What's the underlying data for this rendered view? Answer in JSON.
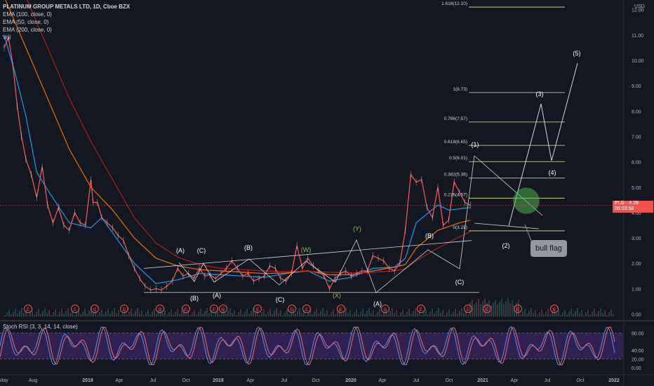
{
  "legend": {
    "title": "PLATINUM GROUP METALS LTD, 1D, Cboe BZX",
    "ema100": "EMA (100, close, 0)",
    "ema50": "EMA (50, close, 0)",
    "ema200": "EMA (200, close, 0)",
    "vol": "Vol"
  },
  "stoch": {
    "label": "Stoch RSI (3, 3, 14, 14, close)"
  },
  "axis": {
    "currency": "USD"
  },
  "price_tag": {
    "symbol": "PLG",
    "price": "4.28",
    "countdown": "06:03:58"
  },
  "annotation": {
    "bull_flag": "bull flag"
  },
  "colors": {
    "background": "#131722",
    "ema50": "#2196f3",
    "ema100": "#ef6c00",
    "ema200": "#b71c1c",
    "candles": "#ef5350",
    "fib": "#f0e68c",
    "stoch_k": "#5b8def",
    "stoch_d": "#ef6c6c",
    "stoch_band": "#4a2a7a",
    "earnings": "#ef5350",
    "breakout_circle": "#4caf50"
  },
  "chart_data": {
    "type": "line",
    "title": "PLATINUM GROUP METALS LTD, 1D, Cboe BZX",
    "price_axis": {
      "min": 0,
      "max": 12,
      "ticks": [
        0.0,
        1.0,
        2.0,
        3.0,
        4.0,
        5.0,
        6.0,
        7.0,
        8.0,
        9.0,
        10.0,
        11.0,
        12.0
      ]
    },
    "time_axis_labels": [
      "May",
      "Aug",
      "2018",
      "Apr",
      "Jul",
      "Oct",
      "2019",
      "Apr",
      "Jul",
      "Oct",
      "2020",
      "Apr",
      "Jul",
      "Oct",
      "2021",
      "Apr",
      "Jul",
      "Oct",
      "2022"
    ],
    "price_series": {
      "name": "PLG",
      "points": [
        [
          0.0,
          10.5
        ],
        [
          0.4,
          10.9
        ],
        [
          0.8,
          9.8
        ],
        [
          1.2,
          8.2
        ],
        [
          1.6,
          7.0
        ],
        [
          2.0,
          6.1
        ],
        [
          2.5,
          5.5
        ],
        [
          3.0,
          4.6
        ],
        [
          3.5,
          5.8
        ],
        [
          4.0,
          4.3
        ],
        [
          4.5,
          3.6
        ],
        [
          5.0,
          4.2
        ],
        [
          5.5,
          3.5
        ],
        [
          6.0,
          3.3
        ],
        [
          6.5,
          4.0
        ],
        [
          7.0,
          3.6
        ],
        [
          7.5,
          3.5
        ],
        [
          8.0,
          5.3
        ],
        [
          8.2,
          4.4
        ],
        [
          8.6,
          4.4
        ],
        [
          9.0,
          3.8
        ],
        [
          9.5,
          3.6
        ],
        [
          10.0,
          3.4
        ],
        [
          10.5,
          3.1
        ],
        [
          11.0,
          2.9
        ],
        [
          11.5,
          2.3
        ],
        [
          12.0,
          1.8
        ],
        [
          12.5,
          1.4
        ],
        [
          13.0,
          1.1
        ],
        [
          13.5,
          0.95
        ],
        [
          14.0,
          1.0
        ],
        [
          14.5,
          0.95
        ],
        [
          15.0,
          1.1
        ],
        [
          15.5,
          1.3
        ],
        [
          16.0,
          1.8
        ],
        [
          16.5,
          1.5
        ],
        [
          17.0,
          1.6
        ],
        [
          17.5,
          1.4
        ],
        [
          18.0,
          1.8
        ],
        [
          18.5,
          1.5
        ],
        [
          19.0,
          1.55
        ],
        [
          19.5,
          1.4
        ],
        [
          20.0,
          1.6
        ],
        [
          20.5,
          1.8
        ],
        [
          21.0,
          2.1
        ],
        [
          21.5,
          1.8
        ],
        [
          22.0,
          1.5
        ],
        [
          22.5,
          1.6
        ],
        [
          23.0,
          1.3
        ],
        [
          23.5,
          1.4
        ],
        [
          24.0,
          1.5
        ],
        [
          24.5,
          1.9
        ],
        [
          25.0,
          1.8
        ],
        [
          25.5,
          1.4
        ],
        [
          26.0,
          1.3
        ],
        [
          26.5,
          1.6
        ],
        [
          27.0,
          2.7
        ],
        [
          27.5,
          1.8
        ],
        [
          28.0,
          2.2
        ],
        [
          28.5,
          1.9
        ],
        [
          29.0,
          1.7
        ],
        [
          29.5,
          1.5
        ],
        [
          30.0,
          1.0
        ],
        [
          30.5,
          1.4
        ],
        [
          31.0,
          1.6
        ],
        [
          31.5,
          1.7
        ],
        [
          32.0,
          1.5
        ],
        [
          32.5,
          1.6
        ],
        [
          33.0,
          1.7
        ],
        [
          33.5,
          1.7
        ],
        [
          34.0,
          2.3
        ],
        [
          34.5,
          2.2
        ],
        [
          35.0,
          2.1
        ],
        [
          35.5,
          1.8
        ],
        [
          36.0,
          1.7
        ],
        [
          36.5,
          2.0
        ],
        [
          37.0,
          3.3
        ],
        [
          37.5,
          5.5
        ],
        [
          38.0,
          5.2
        ],
        [
          38.5,
          5.3
        ],
        [
          39.0,
          4.2
        ],
        [
          39.5,
          3.8
        ],
        [
          40.0,
          5.0
        ],
        [
          40.5,
          3.5
        ],
        [
          41.0,
          3.7
        ],
        [
          41.5,
          5.2
        ],
        [
          42.0,
          4.8
        ],
        [
          42.5,
          4.4
        ],
        [
          43.0,
          4.28
        ]
      ]
    },
    "ema_series": [
      {
        "name": "EMA (50, close, 0)",
        "points": [
          [
            0,
            11.0
          ],
          [
            1,
            9.5
          ],
          [
            2,
            7.8
          ],
          [
            3,
            5.6
          ],
          [
            4,
            4.9
          ],
          [
            6,
            3.6
          ],
          [
            8,
            3.4
          ],
          [
            9,
            3.8
          ],
          [
            10,
            3.2
          ],
          [
            12,
            2.0
          ],
          [
            14,
            1.2
          ],
          [
            16,
            1.35
          ],
          [
            18,
            1.6
          ],
          [
            20,
            1.55
          ],
          [
            22,
            1.5
          ],
          [
            24,
            1.45
          ],
          [
            26,
            1.6
          ],
          [
            28,
            1.7
          ],
          [
            30,
            1.3
          ],
          [
            32,
            1.45
          ],
          [
            34,
            1.8
          ],
          [
            36,
            1.85
          ],
          [
            37,
            2.2
          ],
          [
            38,
            3.6
          ],
          [
            40,
            4.3
          ],
          [
            41,
            4.1
          ],
          [
            43,
            4.2
          ]
        ]
      },
      {
        "name": "EMA (100, close, 0)",
        "points": [
          [
            0,
            12.5
          ],
          [
            2,
            10.5
          ],
          [
            4,
            8.5
          ],
          [
            6,
            6.5
          ],
          [
            8,
            5.0
          ],
          [
            10,
            4.1
          ],
          [
            12,
            3.0
          ],
          [
            14,
            2.2
          ],
          [
            16,
            1.9
          ],
          [
            18,
            1.75
          ],
          [
            20,
            1.7
          ],
          [
            22,
            1.65
          ],
          [
            24,
            1.6
          ],
          [
            26,
            1.62
          ],
          [
            28,
            1.7
          ],
          [
            30,
            1.55
          ],
          [
            32,
            1.55
          ],
          [
            34,
            1.7
          ],
          [
            36,
            1.85
          ],
          [
            37,
            1.95
          ],
          [
            38,
            2.6
          ],
          [
            40,
            3.3
          ],
          [
            42,
            3.6
          ],
          [
            43,
            3.7
          ]
        ]
      },
      {
        "name": "EMA (200, close, 0)",
        "points": [
          [
            2,
            12.5
          ],
          [
            4,
            10.5
          ],
          [
            6,
            8.5
          ],
          [
            8,
            6.8
          ],
          [
            10,
            5.3
          ],
          [
            12,
            3.8
          ],
          [
            14,
            2.8
          ],
          [
            16,
            2.25
          ],
          [
            18,
            1.95
          ],
          [
            20,
            1.8
          ],
          [
            22,
            1.75
          ],
          [
            24,
            1.7
          ],
          [
            26,
            1.68
          ],
          [
            28,
            1.68
          ],
          [
            30,
            1.65
          ],
          [
            32,
            1.62
          ],
          [
            34,
            1.65
          ],
          [
            36,
            1.7
          ],
          [
            37,
            1.78
          ],
          [
            38,
            2.1
          ],
          [
            40,
            2.6
          ],
          [
            42,
            3.05
          ],
          [
            43,
            3.25
          ]
        ]
      }
    ],
    "fib_levels": [
      {
        "label": "1.618(12.10)",
        "price": 12.1
      },
      {
        "label": "1(8.73)",
        "price": 8.73
      },
      {
        "label": "0.786(7.57)",
        "price": 7.57
      },
      {
        "label": "0.618(6.65)",
        "price": 6.65
      },
      {
        "label": "0.5(6.01)",
        "price": 6.01
      },
      {
        "label": "0.382(5.36)",
        "price": 5.36
      },
      {
        "label": "0.236(4.57)",
        "price": 4.57
      },
      {
        "label": "0(3.28)",
        "price": 3.28
      }
    ],
    "wave_labels": [
      {
        "text": "(A)",
        "t": 16.4,
        "p": 2.35
      },
      {
        "text": "(C)",
        "t": 17.9,
        "p": 2.35
      },
      {
        "text": "(B)",
        "t": 17.6,
        "p": 0.3
      },
      {
        "text": "(A)",
        "t": 19.5,
        "p": 0.45
      },
      {
        "text": "(B)",
        "t": 22.5,
        "p": 2.4
      },
      {
        "text": "(C)",
        "t": 25.5,
        "p": 0.3
      },
      {
        "text": "(W)",
        "t": 27.8,
        "p": 2.3
      },
      {
        "text": "(X)",
        "t": 30.8,
        "p": 0.45
      },
      {
        "text": "(Y)",
        "t": 32.6,
        "p": 3.3
      },
      {
        "text": "(A)",
        "t": 34.4,
        "p": 0.1
      },
      {
        "text": "(B)",
        "t": 39.3,
        "p": 2.95
      },
      {
        "text": "(C)",
        "t": 42.0,
        "p": 0.9
      },
      {
        "text": "(1)",
        "t": 43.4,
        "p": 6.6
      },
      {
        "text": "(2)",
        "t": 46.4,
        "p": 2.6
      },
      {
        "text": "(3)",
        "t": 49.3,
        "p": 8.65
      },
      {
        "text": "(4)",
        "t": 50.6,
        "p": 5.6
      },
      {
        "text": "(5)",
        "t": 52.9,
        "p": 10.25
      }
    ],
    "projection_path": [
      [
        47.2,
        4.8
      ],
      [
        49.5,
        8.35
      ],
      [
        50.6,
        6.1
      ],
      [
        53.0,
        10.0
      ]
    ],
    "stoch_rsi": {
      "levels": [
        80,
        20
      ],
      "ticks": [
        0.0,
        20.0,
        40.0,
        80.0
      ]
    }
  }
}
